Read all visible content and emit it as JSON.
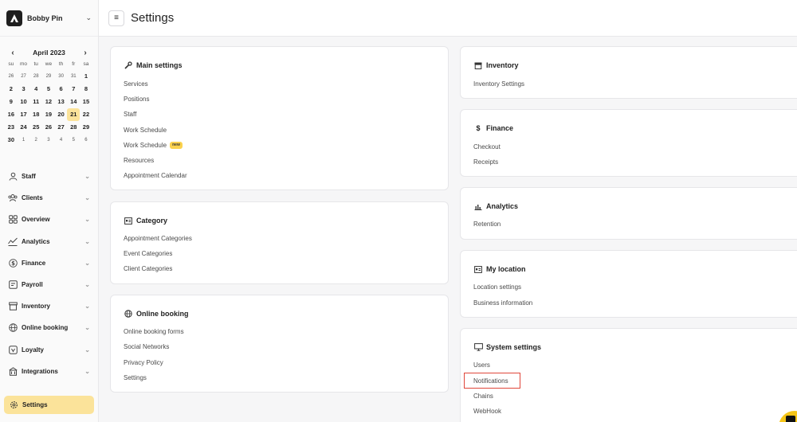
{
  "app": {
    "user_name": "Bobby Pin",
    "page_title": "Settings"
  },
  "calendar": {
    "month_label": "April 2023",
    "weekdays": [
      "su",
      "mo",
      "tu",
      "we",
      "th",
      "fr",
      "sa"
    ],
    "weeks": [
      [
        "26",
        "27",
        "28",
        "29",
        "30",
        "31",
        "1"
      ],
      [
        "2",
        "3",
        "4",
        "5",
        "6",
        "7",
        "8"
      ],
      [
        "9",
        "10",
        "11",
        "12",
        "13",
        "14",
        "15"
      ],
      [
        "16",
        "17",
        "18",
        "19",
        "20",
        "21",
        "22"
      ],
      [
        "23",
        "24",
        "25",
        "26",
        "27",
        "28",
        "29"
      ],
      [
        "30",
        "1",
        "2",
        "3",
        "4",
        "5",
        "6"
      ]
    ],
    "today": "21"
  },
  "sidebar": {
    "items": [
      {
        "label": "Staff",
        "icon": "user-icon"
      },
      {
        "label": "Clients",
        "icon": "users-icon"
      },
      {
        "label": "Overview",
        "icon": "grid-icon"
      },
      {
        "label": "Analytics",
        "icon": "analytics-icon"
      },
      {
        "label": "Finance",
        "icon": "dollar-icon"
      },
      {
        "label": "Payroll",
        "icon": "payroll-icon"
      },
      {
        "label": "Inventory",
        "icon": "box-icon"
      },
      {
        "label": "Online booking",
        "icon": "globe-icon"
      },
      {
        "label": "Loyalty",
        "icon": "loyalty-icon"
      },
      {
        "label": "Integrations",
        "icon": "integrations-icon"
      }
    ],
    "active": {
      "label": "Settings",
      "icon": "gear-icon"
    }
  },
  "cards": {
    "main_settings": {
      "title": "Main settings",
      "links": [
        "Services",
        "Positions",
        "Staff",
        "Work Schedule",
        "Work Schedule",
        "Resources",
        "Appointment Calendar"
      ],
      "badge": "new"
    },
    "category": {
      "title": "Category",
      "links": [
        "Appointment Categories",
        "Event Categories",
        "Client Categories"
      ]
    },
    "online_booking": {
      "title": "Online booking",
      "links": [
        "Online booking forms",
        "Social Networks",
        "Privacy Policy",
        "Settings"
      ]
    },
    "inventory": {
      "title": "Inventory",
      "links": [
        "Inventory Settings"
      ]
    },
    "finance": {
      "title": "Finance",
      "links": [
        "Checkout",
        "Receipts"
      ]
    },
    "analytics": {
      "title": "Analytics",
      "links": [
        "Retention"
      ]
    },
    "my_location": {
      "title": "My location",
      "links": [
        "Location settings",
        "Business information"
      ]
    },
    "system_settings": {
      "title": "System settings",
      "links": [
        "Users",
        "Notifications",
        "Chains",
        "WebHook"
      ]
    }
  },
  "colors": {
    "accent": "#fbe39a",
    "badge": "#fbd24e",
    "highlight_border": "#e0463a",
    "fab": "#f5c518"
  }
}
